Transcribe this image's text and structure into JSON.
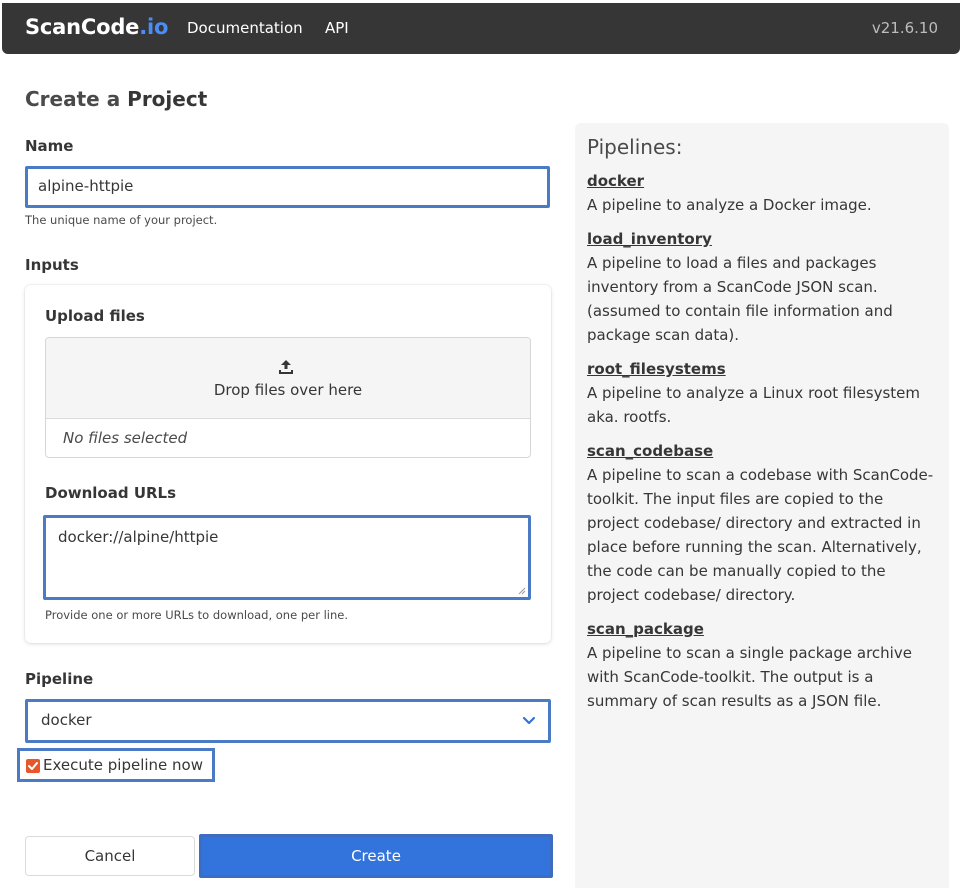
{
  "navbar": {
    "brand_main": "ScanCode",
    "brand_suffix": ".io",
    "links": [
      "Documentation",
      "API"
    ],
    "version": "v21.6.10"
  },
  "page": {
    "title_prefix": "Create a ",
    "title_bold": "Project"
  },
  "form": {
    "name_label": "Name",
    "name_value": "alpine-httpie",
    "name_help": "The unique name of your project.",
    "inputs_label": "Inputs",
    "upload_label": "Upload files",
    "drop_text": "Drop files over here",
    "no_files_text": "No files selected",
    "download_label": "Download URLs",
    "download_value": "docker://alpine/httpie",
    "download_help": "Provide one or more URLs to download, one per line.",
    "pipeline_label": "Pipeline",
    "pipeline_selected": "docker",
    "execute_label": "Execute pipeline now",
    "execute_checked": true,
    "cancel_label": "Cancel",
    "create_label": "Create"
  },
  "pipelines": {
    "title": "Pipelines:",
    "items": [
      {
        "name": "docker",
        "description": "A pipeline to analyze a Docker image."
      },
      {
        "name": "load_inventory",
        "description": "A pipeline to load a files and packages inventory from a ScanCode JSON scan. (assumed to contain file information and package scan data)."
      },
      {
        "name": "root_filesystems",
        "description": "A pipeline to analyze a Linux root filesystem aka. rootfs."
      },
      {
        "name": "scan_codebase",
        "description": "A pipeline to scan a codebase with ScanCode-toolkit. The input files are copied to the project codebase/ directory and extracted in place before running the scan. Alternatively, the code can be manually copied to the project codebase/ directory."
      },
      {
        "name": "scan_package",
        "description": "A pipeline to scan a single package archive with ScanCode-toolkit. The output is a summary of scan results as a JSON file."
      }
    ]
  },
  "colors": {
    "navbar_bg": "#363636",
    "focus_border": "#4a7bc4",
    "primary": "#3273dc",
    "checkbox": "#e8572b"
  }
}
